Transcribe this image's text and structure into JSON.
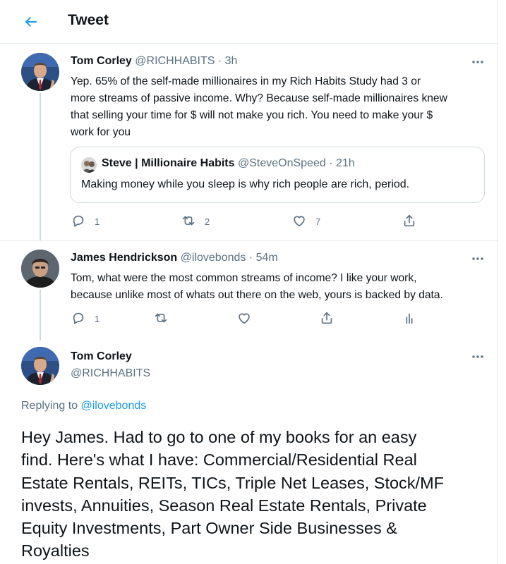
{
  "header": {
    "title": "Tweet"
  },
  "tweet1": {
    "name": "Tom Corley",
    "handle": "@RICHHABITS",
    "time": "· 3h",
    "text_lines": [
      "Yep. 65% of the self-made millionaires in my Rich Habits Study had 3 or",
      "more streams of passive income. Why? Because self-made millionaires knew",
      "that selling your time for $ will not make you rich. You need to make your $",
      "work for you"
    ],
    "quote": {
      "name": "Steve | Millionaire Habits",
      "handle": "@SteveOnSpeed",
      "time": "· 21h",
      "text": "Making money while you sleep is why rich people are rich, period."
    },
    "actions": {
      "replies": "1",
      "retweets": "2",
      "likes": "7"
    }
  },
  "tweet2": {
    "name": "James Hendrickson",
    "handle": "@ilovebonds",
    "time": "· 54m",
    "text_lines": [
      "Tom, what were the most common streams of income?  I like your work,",
      "because unlike most of whats out there on the web, yours is backed by data."
    ],
    "actions": {
      "replies": "1"
    }
  },
  "main": {
    "name": "Tom Corley",
    "handle": "@RICHHABITS",
    "replying_prefix": "Replying to",
    "replying_to": "@ilovebonds",
    "text_lines": [
      "Hey James. Had to go to one of my books for an easy",
      "find. Here's what I have: Commercial/Residential Real",
      "Estate Rentals, REITs, TICs, Triple Net Leases, Stock/MF",
      "invests, Annuities, Season Real Estate Rentals, Private",
      "Equity Investments, Part Owner Side Businesses &",
      "Royalties"
    ]
  },
  "colors": {
    "accent": "#1d9bf0",
    "muted": "#5b7083",
    "border": "#e6ecf0"
  },
  "icons": [
    "back-arrow-icon",
    "more-icon",
    "reply-icon",
    "retweet-icon",
    "like-icon",
    "share-icon",
    "analytics-icon"
  ]
}
